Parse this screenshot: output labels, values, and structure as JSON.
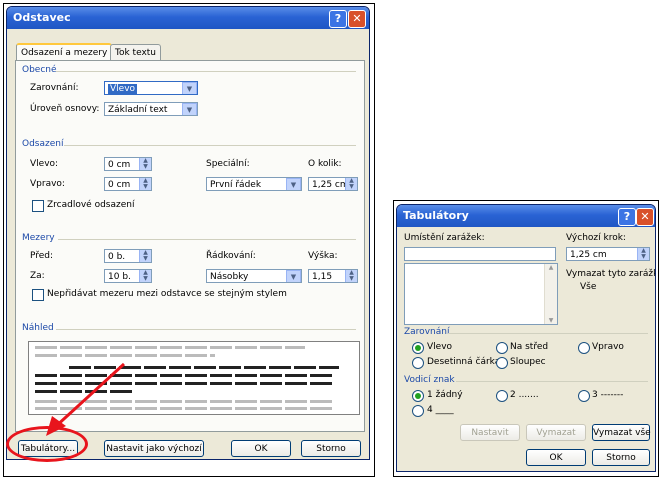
{
  "left_dialog": {
    "title": "Odstavec",
    "tabs": [
      "Odsazení a mezery",
      "Tok textu"
    ],
    "obecne": {
      "group": "Obecné",
      "zarovnani_label": "Zarovnání:",
      "zarovnani_value": "Vlevo",
      "uroven_label": "Úroveň osnovy:",
      "uroven_value": "Základní text"
    },
    "odsazeni": {
      "group": "Odsazení",
      "vlevo_label": "Vlevo:",
      "vlevo_value": "0 cm",
      "vpravo_label": "Vpravo:",
      "vpravo_value": "0 cm",
      "specialni_label": "Speciální:",
      "specialni_value": "První řádek",
      "okolik_label": "O kolik:",
      "okolik_value": "1,25 cm",
      "zrcadlove_label": "Zrcadlové odsazení"
    },
    "mezery": {
      "group": "Mezery",
      "pred_label": "Před:",
      "pred_value": "0 b.",
      "za_label": "Za:",
      "za_value": "10 b.",
      "radkovani_label": "Řádkování:",
      "radkovani_value": "Násobky",
      "vyska_label": "Výška:",
      "vyska_value": "1,15",
      "nepridavat_label": "Nepřidávat mezeru mezi odstavce se stejným stylem"
    },
    "nahled": {
      "group": "Náhled"
    },
    "buttons": {
      "tabulatory": "Tabulátory...",
      "nastavit_vychozi": "Nastavit jako výchozí",
      "ok": "OK",
      "storno": "Storno"
    }
  },
  "right_dialog": {
    "title": "Tabulátory",
    "umisteni_label": "Umístění zarážek:",
    "vychozi_krok_label": "Výchozí krok:",
    "vychozi_krok_value": "1,25 cm",
    "vymazat_label": "Vymazat tyto zarážky:",
    "vymazat_value": "Vše",
    "zarovnani": {
      "group": "Zarovnání",
      "options": [
        "Vlevo",
        "Na střed",
        "Vpravo",
        "Desetinná čárka",
        "Sloupec"
      ]
    },
    "vodici": {
      "group": "Vodicí znak",
      "options": [
        "1 žádný",
        "2 .......",
        "3 -------",
        "4 ____"
      ]
    },
    "buttons": {
      "nastavit": "Nastavit",
      "vymazat": "Vymazat",
      "vymazat_vse": "Vymazat vše",
      "ok": "OK",
      "storno": "Storno"
    }
  },
  "colors": {
    "annotation_red": "#e8141c",
    "title_blue": "#2a63d4",
    "group_blue": "#1c49a8"
  }
}
